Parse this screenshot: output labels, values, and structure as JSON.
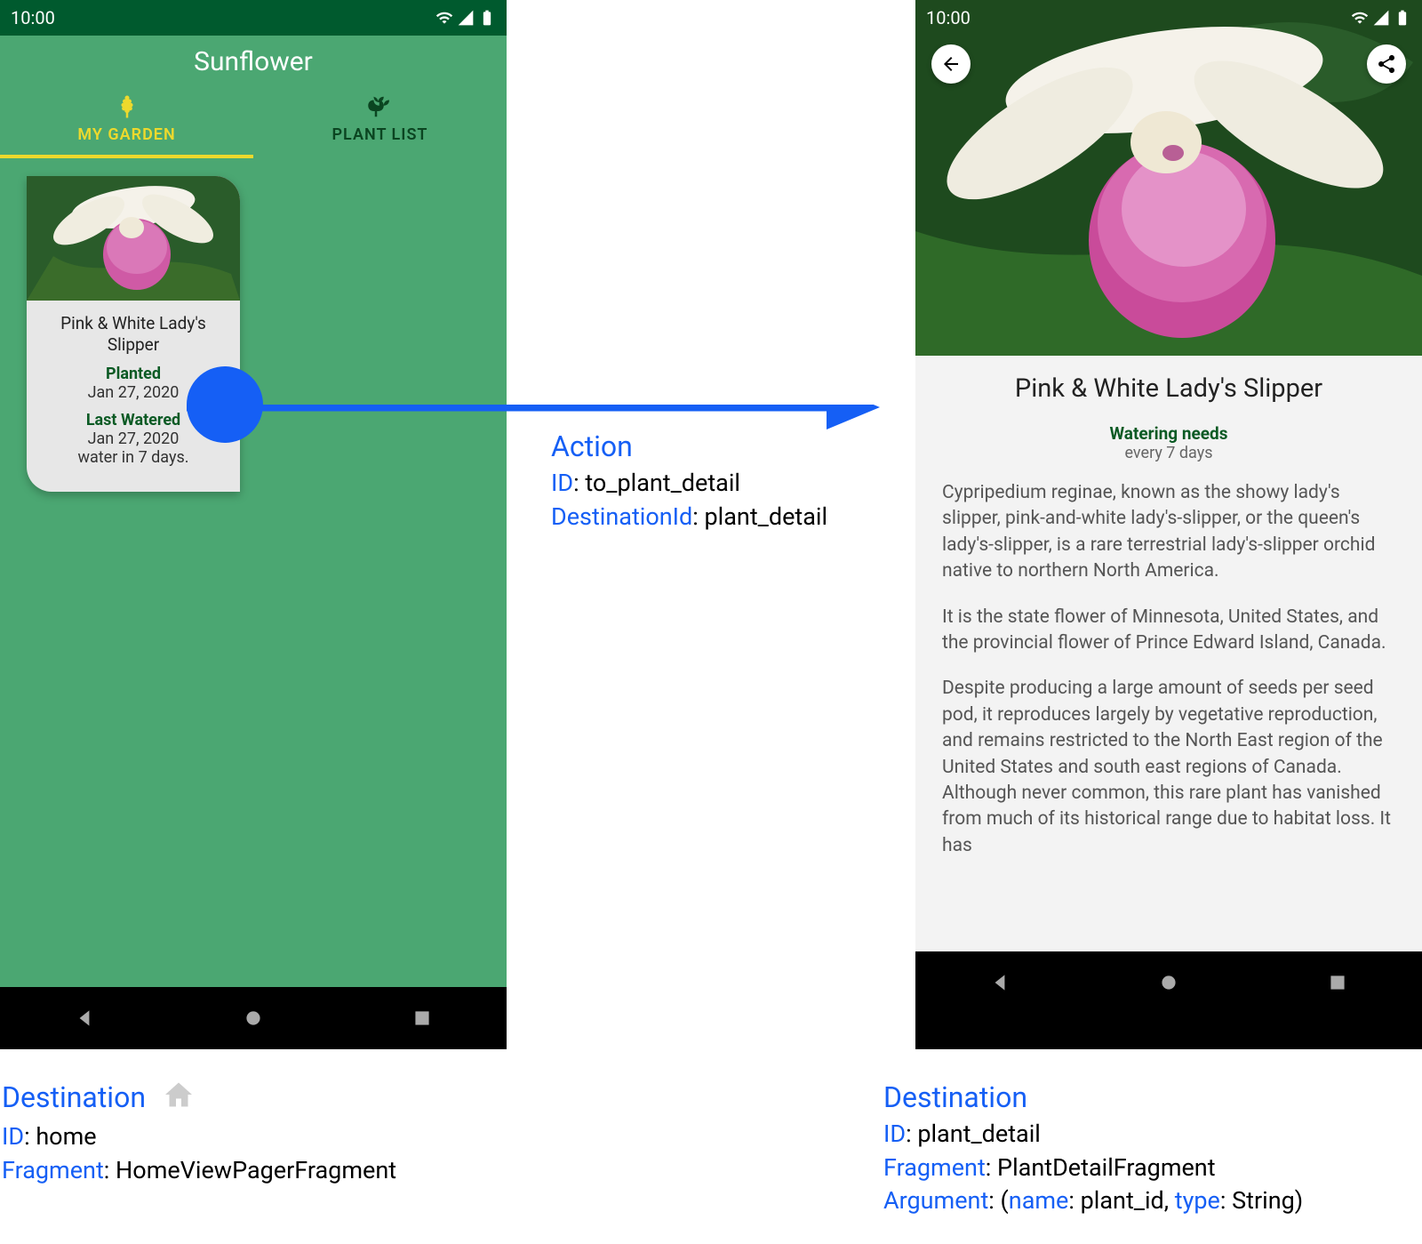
{
  "status": {
    "time": "10:00"
  },
  "left_screen": {
    "app_title": "Sunflower",
    "tabs": {
      "my_garden": "MY GARDEN",
      "plant_list": "PLANT LIST"
    },
    "card": {
      "name": "Pink & White Lady's Slipper",
      "planted_label": "Planted",
      "planted_date": "Jan 27, 2020",
      "watered_label": "Last Watered",
      "watered_date": "Jan 27, 2020",
      "watered_hint": "water in 7 days."
    }
  },
  "right_screen": {
    "title": "Pink & White Lady's Slipper",
    "watering_label": "Watering needs",
    "watering_value": "every 7 days",
    "description_p1": "Cypripedium reginae, known as the showy lady's slipper, pink-and-white lady's-slipper, or the queen's lady's-slipper, is a rare terrestrial lady's-slipper orchid native to northern North America.",
    "description_p2": "It is the state flower of Minnesota, United States, and the provincial flower of Prince Edward Island, Canada.",
    "description_p3": "Despite producing a large amount of seeds per seed pod, it reproduces largely by vegetative reproduction, and remains restricted to the North East region of the United States and south east regions of Canada. Although never common, this rare plant has vanished from much of its historical range due to habitat loss. It has"
  },
  "action": {
    "heading": "Action",
    "id_label": "ID",
    "id_value": "to_plant_detail",
    "dest_label": "DestinationId",
    "dest_value": "plant_detail"
  },
  "dest_left": {
    "heading": "Destination",
    "id_label": "ID",
    "id_value": "home",
    "frag_label": "Fragment",
    "frag_value": "HomeViewPagerFragment"
  },
  "dest_right": {
    "heading": "Destination",
    "id_label": "ID",
    "id_value": "plant_detail",
    "frag_label": "Fragment",
    "frag_value": "PlantDetailFragment",
    "arg_label": "Argument",
    "arg_name_label": "name",
    "arg_name_value": "plant_id",
    "arg_type_label": "type",
    "arg_type_value": "String"
  }
}
